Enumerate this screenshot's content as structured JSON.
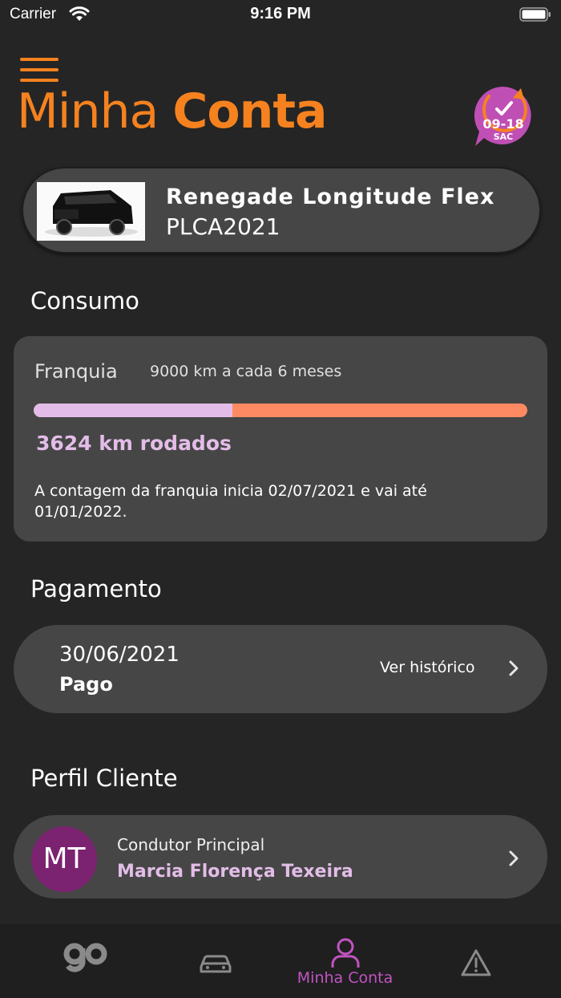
{
  "status_bar": {
    "carrier": "Carrier",
    "time": "9:16 PM"
  },
  "header": {
    "title_light": "Minha ",
    "title_bold": "Conta",
    "sac_badge": {
      "hours": "09-18",
      "label": "SAC",
      "icon": "clock-check-icon"
    }
  },
  "vehicle": {
    "name": "Renegade Longitude Flex",
    "plate": "PLCA2021"
  },
  "consumo": {
    "section_title": "Consumo",
    "franquia_label": "Franquia",
    "franquia_value": "9000 km a cada 6 meses",
    "progress_fraction": 0.403,
    "km_rodados": "3624 km rodados",
    "note": "A contagem da franquia inicia 02/07/2021 e vai até 01/01/2022."
  },
  "pagamento": {
    "section_title": "Pagamento",
    "date": "30/06/2021",
    "status": "Pago",
    "history_link": "Ver histórico"
  },
  "perfil": {
    "section_title": "Perfil Cliente",
    "initials": "MT",
    "role": "Condutor Principal",
    "name": "Marcia Florença Texeira"
  },
  "tab_bar": {
    "tabs": [
      {
        "icon": "go-logo-icon",
        "label": ""
      },
      {
        "icon": "car-icon",
        "label": ""
      },
      {
        "icon": "person-icon",
        "label": "Minha Conta",
        "active": true
      },
      {
        "icon": "warning-icon",
        "label": ""
      }
    ]
  },
  "colors": {
    "background": "#252525",
    "card": "#464646",
    "accent_orange": "#f5821f",
    "accent_purple": "#c254c2",
    "lavender": "#e3bde8",
    "progress_remaining": "#fd8a63",
    "avatar": "#7b2370"
  }
}
